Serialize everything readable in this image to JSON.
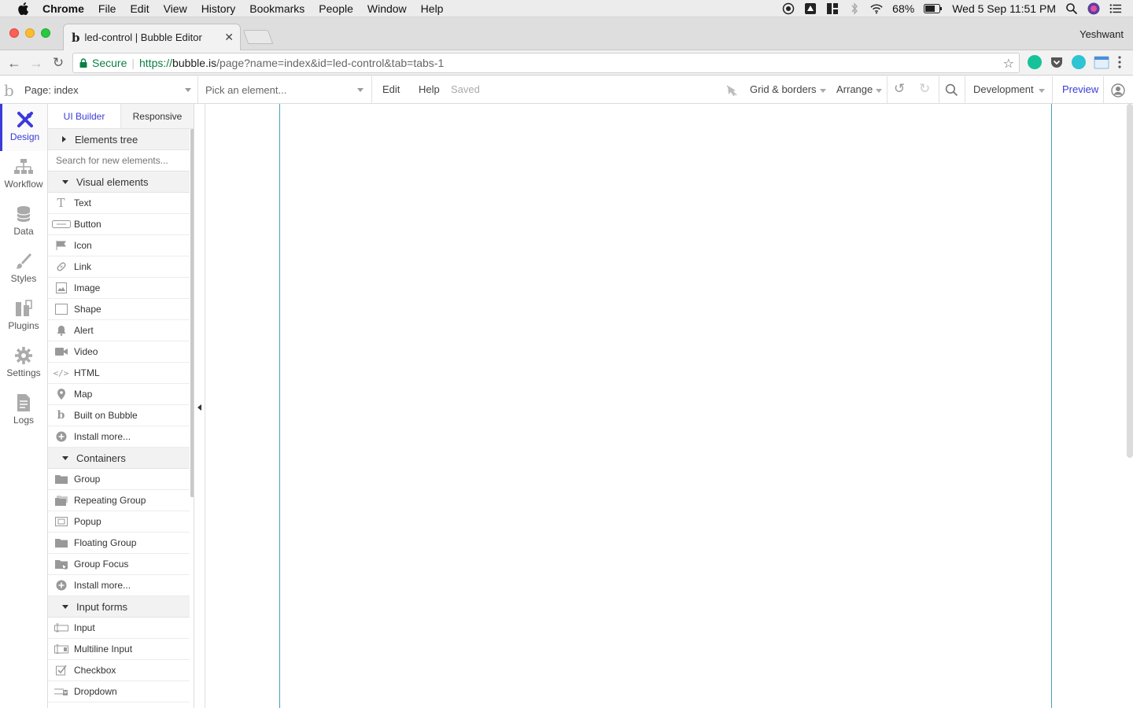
{
  "menubar": {
    "app": "Chrome",
    "items": [
      "File",
      "Edit",
      "View",
      "History",
      "Bookmarks",
      "People",
      "Window",
      "Help"
    ],
    "battery": "68%",
    "datetime": "Wed 5 Sep  11:51 PM"
  },
  "browser": {
    "tab_title": "led-control | Bubble Editor",
    "tab_favicon": "b",
    "profile": "Yeshwant",
    "secure_label": "Secure",
    "url_scheme": "https://",
    "url_domain": "bubble.is",
    "url_path": "/page?name=index&id=led-control&tab=tabs-1"
  },
  "editor": {
    "logo": "b",
    "page_label": "Page: index",
    "pick_element": "Pick an element...",
    "menu_edit": "Edit",
    "menu_help": "Help",
    "saved_status": "Saved",
    "grid_borders": "Grid & borders",
    "arrange": "Arrange",
    "environment": "Development",
    "preview": "Preview"
  },
  "leftnav": [
    {
      "label": "Design",
      "icon": "design-icon"
    },
    {
      "label": "Workflow",
      "icon": "workflow-icon"
    },
    {
      "label": "Data",
      "icon": "database-icon"
    },
    {
      "label": "Styles",
      "icon": "brush-icon"
    },
    {
      "label": "Plugins",
      "icon": "plug-icon"
    },
    {
      "label": "Settings",
      "icon": "gear-icon"
    },
    {
      "label": "Logs",
      "icon": "document-icon"
    }
  ],
  "panel": {
    "tab_ui_builder": "UI Builder",
    "tab_responsive": "Responsive",
    "elements_tree": "Elements tree",
    "search_placeholder": "Search for new elements...",
    "visual_elements": {
      "title": "Visual elements",
      "items": [
        "Text",
        "Button",
        "Icon",
        "Link",
        "Image",
        "Shape",
        "Alert",
        "Video",
        "HTML",
        "Map",
        "Built on Bubble",
        "Install more..."
      ]
    },
    "containers": {
      "title": "Containers",
      "items": [
        "Group",
        "Repeating Group",
        "Popup",
        "Floating Group",
        "Group Focus",
        "Install more..."
      ]
    },
    "input_forms": {
      "title": "Input forms",
      "items": [
        "Input",
        "Multiline Input",
        "Checkbox",
        "Dropdown"
      ]
    }
  },
  "colors": {
    "accent": "#3b3bd9",
    "secure_green": "#0b8043",
    "guide": "#4a9fb5"
  }
}
